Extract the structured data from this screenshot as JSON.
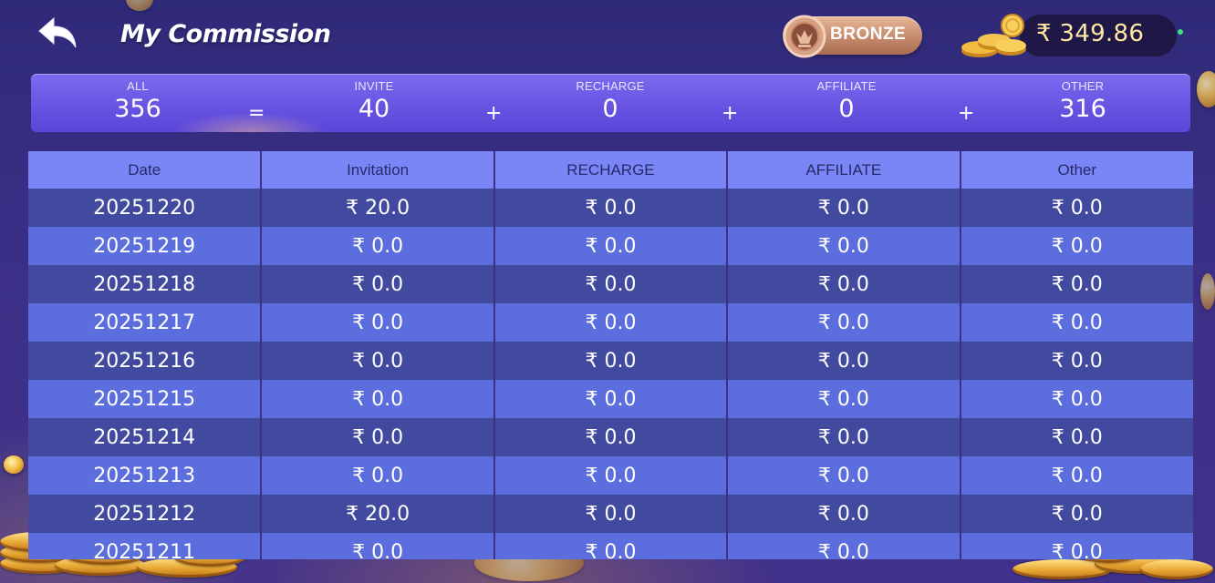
{
  "header": {
    "title": "My Commission",
    "rank_label": "BRONZE",
    "balance": "₹ 349.86"
  },
  "summary": {
    "all": {
      "label": "ALL",
      "value": "356"
    },
    "invite": {
      "label": "INVITE",
      "value": "40"
    },
    "recharge": {
      "label": "RECHARGE",
      "value": "0"
    },
    "affiliate": {
      "label": "AFFILIATE",
      "value": "0"
    },
    "other": {
      "label": "OTHER",
      "value": "316"
    },
    "operators": [
      "=",
      "+",
      "+",
      "+"
    ]
  },
  "table": {
    "columns": [
      "Date",
      "Invitation",
      "RECHARGE",
      "AFFILIATE",
      "Other"
    ],
    "rows": [
      [
        "20251220",
        "₹ 20.0",
        "₹ 0.0",
        "₹ 0.0",
        "₹ 0.0"
      ],
      [
        "20251219",
        "₹ 0.0",
        "₹ 0.0",
        "₹ 0.0",
        "₹ 0.0"
      ],
      [
        "20251218",
        "₹ 0.0",
        "₹ 0.0",
        "₹ 0.0",
        "₹ 0.0"
      ],
      [
        "20251217",
        "₹ 0.0",
        "₹ 0.0",
        "₹ 0.0",
        "₹ 0.0"
      ],
      [
        "20251216",
        "₹ 0.0",
        "₹ 0.0",
        "₹ 0.0",
        "₹ 0.0"
      ],
      [
        "20251215",
        "₹ 0.0",
        "₹ 0.0",
        "₹ 0.0",
        "₹ 0.0"
      ],
      [
        "20251214",
        "₹ 0.0",
        "₹ 0.0",
        "₹ 0.0",
        "₹ 0.0"
      ],
      [
        "20251213",
        "₹ 0.0",
        "₹ 0.0",
        "₹ 0.0",
        "₹ 0.0"
      ],
      [
        "20251212",
        "₹ 20.0",
        "₹ 0.0",
        "₹ 0.0",
        "₹ 0.0"
      ],
      [
        "20251211",
        "₹ 0.0",
        "₹ 0.0",
        "₹ 0.0",
        "₹ 0.0"
      ]
    ]
  },
  "colors": {
    "background": "#3a2f86",
    "summary_bar": "#6a56e3",
    "table_header": "#7b86f6",
    "row_dark": "#414a9e",
    "row_light": "#5c6ddd",
    "balance_text": "#ffe7a6",
    "rank_badge": "#c58a6c"
  },
  "icons": {
    "back": "back-arrow-icon",
    "rank": "bronze-medal-icon",
    "balance": "gold-coins-icon"
  }
}
